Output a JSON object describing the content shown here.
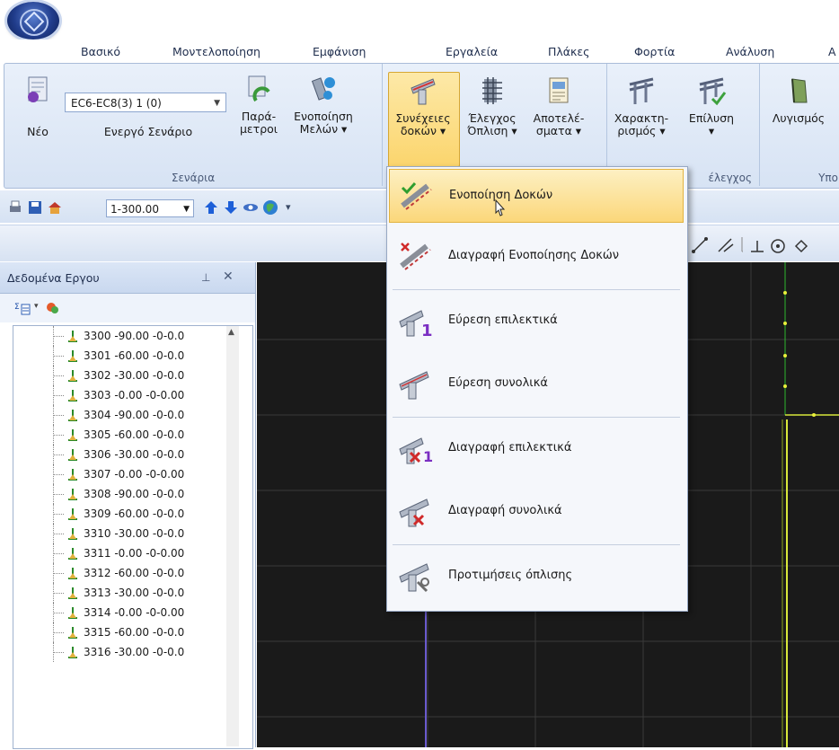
{
  "menu_tabs": [
    "Βασικό",
    "Μοντελοποίηση",
    "Εμφάνιση",
    "Εργαλεία",
    "Πλάκες",
    "Φορτία",
    "Ανάλυση",
    "Α"
  ],
  "ribbon": {
    "scenario_combo": "EC6-EC8(3) 1 (0)",
    "new_label": "Νέο",
    "active_scenario_label": "Ενεργό Σενάριο",
    "params_label_1": "Παρά-",
    "params_label_2": "μετροι",
    "merge_label_1": "Ενοποίηση",
    "merge_label_2": "Μελών",
    "group_scenarios": "Σενάρια",
    "beams_label_1": "Συνέχειες",
    "beams_label_2": "δοκών",
    "check_label_1": "Έλεγχος",
    "check_label_2": "Όπλιση",
    "results_label_1": "Αποτελέ-",
    "results_label_2": "σματα",
    "char_label_1": "Χαρακτη-",
    "char_label_2": "ρισμός",
    "solve_label": "Επίλυση",
    "group_check": "έλεγχος",
    "buckling_label": "Λυγισμός",
    "group_right": "Υπο"
  },
  "quick_access": {
    "level": "1-300.00"
  },
  "panel": {
    "title": "Δεδομένα Εργου",
    "rows": [
      "3300 -90.00 -0-0.0",
      "3301 -60.00 -0-0.0",
      "3302 -30.00 -0-0.0",
      "3303 -0.00 -0-0.00",
      "3304 -90.00 -0-0.0",
      "3305 -60.00 -0-0.0",
      "3306 -30.00 -0-0.0",
      "3307 -0.00 -0-0.00",
      "3308 -90.00 -0-0.0",
      "3309 -60.00 -0-0.0",
      "3310 -30.00 -0-0.0",
      "3311 -0.00 -0-0.00",
      "3312 -60.00 -0-0.0",
      "3313 -30.00 -0-0.0",
      "3314 -0.00 -0-0.00",
      "3315 -60.00 -0-0.0",
      "3316 -30.00 -0-0.0"
    ]
  },
  "dropdown": {
    "items": [
      "Ενοποίηση Δοκών",
      "Διαγραφή Ενοποίησης Δοκών",
      "Εύρεση επιλεκτικά",
      "Εύρεση συνολικά",
      "Διαγραφή επιλεκτικά",
      "Διαγραφή συνολικά",
      "Προτιμήσεις όπλισης"
    ]
  }
}
